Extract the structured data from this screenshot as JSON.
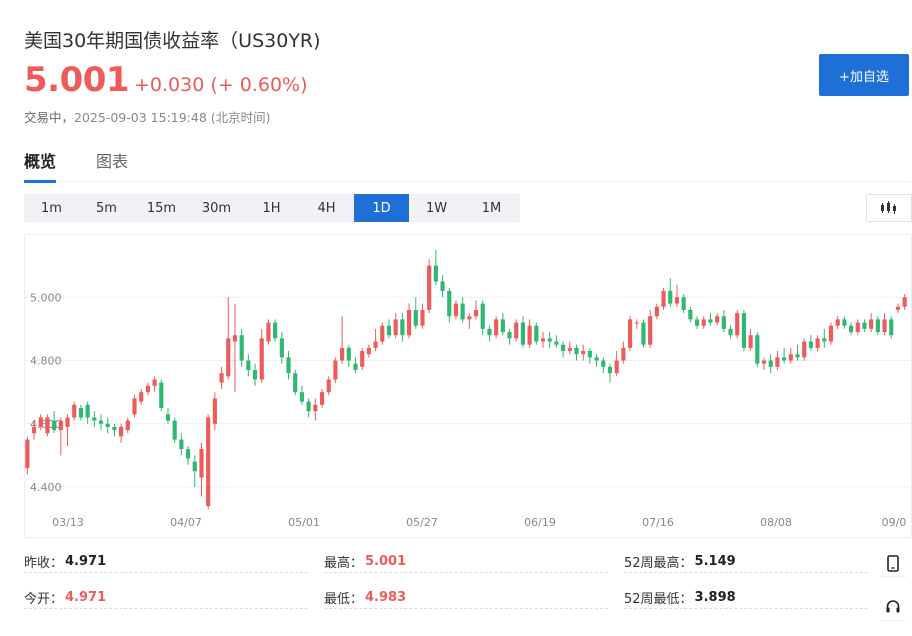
{
  "header": {
    "title": "美国30年期国债收益率（US30YR)",
    "price": "5.001",
    "change": "+0.030 (+ 0.60%)",
    "status": "交易中，",
    "timestamp": "2025-09-03 15:19:48 (北京时间)",
    "add_button": "+加自选"
  },
  "tabs": [
    {
      "label": "概览",
      "active": true
    },
    {
      "label": "图表",
      "active": false
    }
  ],
  "periods": [
    {
      "label": "1m",
      "active": false
    },
    {
      "label": "5m",
      "active": false
    },
    {
      "label": "15m",
      "active": false
    },
    {
      "label": "30m",
      "active": false
    },
    {
      "label": "1H",
      "active": false
    },
    {
      "label": "4H",
      "active": false
    },
    {
      "label": "1D",
      "active": true
    },
    {
      "label": "1W",
      "active": false
    },
    {
      "label": "1M",
      "active": false
    }
  ],
  "stats": {
    "prev_close_label": "昨收：",
    "prev_close": "4.971",
    "open_label": "今开：",
    "open": "4.971",
    "high_label": "最高：",
    "high": "5.001",
    "low_label": "最低：",
    "low": "4.983",
    "wk52_high_label": "52周最高：",
    "wk52_high": "5.149",
    "wk52_low_label": "52周最低：",
    "wk52_low": "3.898"
  },
  "colors": {
    "up": "#ee5b5b",
    "down": "#2eb872",
    "accent": "#1f70d6"
  },
  "icons": {
    "chart_type": "candlestick-icon",
    "mobile": "mobile-phone-icon",
    "support": "headset-icon"
  },
  "chart_data": {
    "type": "candlestick",
    "title": "",
    "xlabel": "",
    "ylabel": "",
    "yticks": [
      "4.400",
      "4.600",
      "4.800",
      "5.000"
    ],
    "ylim": [
      4.34,
      5.2
    ],
    "xtick_labels": [
      "03/13",
      "04/07",
      "05/01",
      "05/27",
      "06/19",
      "07/16",
      "08/08",
      "09/0"
    ],
    "grid": true,
    "legend": false,
    "candles": [
      [
        4.46,
        4.55,
        4.44,
        4.56
      ],
      [
        4.57,
        4.59,
        4.55,
        4.61
      ],
      [
        4.59,
        4.62,
        4.58,
        4.63
      ],
      [
        4.57,
        4.62,
        4.56,
        4.63
      ],
      [
        4.61,
        4.58,
        4.57,
        4.64
      ],
      [
        4.58,
        4.61,
        4.5,
        4.62
      ],
      [
        4.59,
        4.62,
        4.53,
        4.63
      ],
      [
        4.62,
        4.66,
        4.61,
        4.67
      ],
      [
        4.65,
        4.62,
        4.61,
        4.66
      ],
      [
        4.66,
        4.62,
        4.6,
        4.67
      ],
      [
        4.62,
        4.61,
        4.59,
        4.64
      ],
      [
        4.61,
        4.6,
        4.58,
        4.63
      ],
      [
        4.6,
        4.59,
        4.57,
        4.62
      ],
      [
        4.59,
        4.58,
        4.56,
        4.6
      ],
      [
        4.56,
        4.59,
        4.54,
        4.6
      ],
      [
        4.58,
        4.61,
        4.57,
        4.62
      ],
      [
        4.63,
        4.68,
        4.62,
        4.69
      ],
      [
        4.67,
        4.7,
        4.66,
        4.71
      ],
      [
        4.7,
        4.72,
        4.69,
        4.73
      ],
      [
        4.72,
        4.74,
        4.7,
        4.75
      ],
      [
        4.73,
        4.65,
        4.64,
        4.74
      ],
      [
        4.63,
        4.61,
        4.6,
        4.65
      ],
      [
        4.61,
        4.55,
        4.54,
        4.62
      ],
      [
        4.55,
        4.52,
        4.5,
        4.57
      ],
      [
        4.52,
        4.49,
        4.47,
        4.53
      ],
      [
        4.48,
        4.45,
        4.4,
        4.5
      ],
      [
        4.43,
        4.52,
        4.37,
        4.54
      ],
      [
        4.34,
        4.62,
        4.33,
        4.63
      ],
      [
        4.6,
        4.68,
        4.58,
        4.7
      ],
      [
        4.73,
        4.76,
        4.71,
        4.78
      ],
      [
        4.75,
        4.87,
        4.74,
        5.0
      ],
      [
        4.86,
        4.88,
        4.7,
        4.98
      ],
      [
        4.88,
        4.8,
        4.78,
        4.9
      ],
      [
        4.8,
        4.77,
        4.75,
        4.82
      ],
      [
        4.77,
        4.74,
        4.72,
        4.79
      ],
      [
        4.74,
        4.87,
        4.73,
        4.9
      ],
      [
        4.86,
        4.92,
        4.85,
        4.93
      ],
      [
        4.92,
        4.87,
        4.86,
        4.93
      ],
      [
        4.87,
        4.81,
        4.79,
        4.89
      ],
      [
        4.81,
        4.76,
        4.74,
        4.83
      ],
      [
        4.76,
        4.7,
        4.69,
        4.77
      ],
      [
        4.7,
        4.67,
        4.66,
        4.72
      ],
      [
        4.67,
        4.64,
        4.62,
        4.68
      ],
      [
        4.64,
        4.66,
        4.61,
        4.68
      ],
      [
        4.66,
        4.7,
        4.65,
        4.71
      ],
      [
        4.7,
        4.74,
        4.69,
        4.75
      ],
      [
        4.74,
        4.8,
        4.73,
        4.81
      ],
      [
        4.8,
        4.84,
        4.79,
        4.94
      ],
      [
        4.84,
        4.8,
        4.78,
        4.85
      ],
      [
        4.79,
        4.77,
        4.76,
        4.81
      ],
      [
        4.78,
        4.83,
        4.77,
        4.84
      ],
      [
        4.82,
        4.84,
        4.81,
        4.85
      ],
      [
        4.84,
        4.86,
        4.83,
        4.9
      ],
      [
        4.86,
        4.91,
        4.85,
        4.92
      ],
      [
        4.91,
        4.88,
        4.87,
        4.93
      ],
      [
        4.88,
        4.93,
        4.87,
        4.95
      ],
      [
        4.93,
        4.88,
        4.86,
        4.95
      ],
      [
        4.88,
        4.96,
        4.87,
        4.98
      ],
      [
        4.96,
        4.91,
        4.9,
        5.0
      ],
      [
        4.91,
        4.96,
        4.9,
        4.98
      ],
      [
        4.96,
        5.1,
        4.95,
        5.12
      ],
      [
        5.1,
        5.05,
        5.04,
        5.15
      ],
      [
        5.05,
        5.02,
        5.0,
        5.07
      ],
      [
        5.02,
        4.94,
        4.92,
        5.03
      ],
      [
        4.94,
        4.98,
        4.93,
        4.99
      ],
      [
        4.98,
        4.93,
        4.92,
        5.0
      ],
      [
        4.93,
        4.94,
        4.9,
        4.95
      ],
      [
        4.94,
        4.96,
        4.93,
        4.99
      ],
      [
        4.98,
        4.9,
        4.88,
        4.99
      ],
      [
        4.9,
        4.88,
        4.86,
        4.91
      ],
      [
        4.88,
        4.93,
        4.87,
        4.94
      ],
      [
        4.93,
        4.89,
        4.88,
        4.95
      ],
      [
        4.89,
        4.87,
        4.85,
        4.9
      ],
      [
        4.87,
        4.92,
        4.86,
        4.93
      ],
      [
        4.92,
        4.85,
        4.84,
        4.94
      ],
      [
        4.85,
        4.91,
        4.84,
        4.93
      ],
      [
        4.91,
        4.86,
        4.85,
        4.92
      ],
      [
        4.86,
        4.87,
        4.84,
        4.89
      ],
      [
        4.87,
        4.86,
        4.84,
        4.89
      ],
      [
        4.86,
        4.85,
        4.84,
        4.88
      ],
      [
        4.85,
        4.83,
        4.81,
        4.86
      ],
      [
        4.83,
        4.84,
        4.82,
        4.86
      ],
      [
        4.84,
        4.82,
        4.8,
        4.85
      ],
      [
        4.82,
        4.83,
        4.8,
        4.85
      ],
      [
        4.83,
        4.81,
        4.79,
        4.84
      ],
      [
        4.81,
        4.8,
        4.78,
        4.82
      ],
      [
        4.8,
        4.78,
        4.76,
        4.81
      ],
      [
        4.78,
        4.76,
        4.73,
        4.79
      ],
      [
        4.76,
        4.8,
        4.75,
        4.83
      ],
      [
        4.8,
        4.84,
        4.79,
        4.86
      ],
      [
        4.84,
        4.93,
        4.83,
        4.94
      ],
      [
        4.92,
        4.92,
        4.9,
        4.93
      ],
      [
        4.92,
        4.85,
        4.84,
        4.93
      ],
      [
        4.85,
        4.94,
        4.84,
        4.96
      ],
      [
        4.94,
        4.97,
        4.93,
        4.98
      ],
      [
        4.97,
        5.02,
        4.96,
        5.03
      ],
      [
        5.02,
        4.98,
        4.97,
        5.06
      ],
      [
        4.98,
        5.0,
        4.97,
        5.04
      ],
      [
        5.0,
        4.96,
        4.95,
        5.01
      ],
      [
        4.96,
        4.93,
        4.92,
        4.97
      ],
      [
        4.93,
        4.91,
        4.9,
        4.94
      ],
      [
        4.91,
        4.93,
        4.9,
        4.94
      ],
      [
        4.93,
        4.92,
        4.91,
        4.95
      ],
      [
        4.92,
        4.94,
        4.91,
        4.95
      ],
      [
        4.94,
        4.9,
        4.89,
        4.96
      ],
      [
        4.9,
        4.88,
        4.87,
        4.91
      ],
      [
        4.88,
        4.95,
        4.87,
        4.96
      ],
      [
        4.95,
        4.84,
        4.83,
        4.96
      ],
      [
        4.84,
        4.88,
        4.83,
        4.9
      ],
      [
        4.88,
        4.79,
        4.78,
        4.89
      ],
      [
        4.79,
        4.8,
        4.77,
        4.81
      ],
      [
        4.8,
        4.78,
        4.76,
        4.82
      ],
      [
        4.78,
        4.81,
        4.77,
        4.83
      ],
      [
        4.81,
        4.8,
        4.79,
        4.84
      ],
      [
        4.8,
        4.82,
        4.79,
        4.84
      ],
      [
        4.82,
        4.81,
        4.8,
        4.85
      ],
      [
        4.81,
        4.86,
        4.8,
        4.87
      ],
      [
        4.86,
        4.84,
        4.83,
        4.88
      ],
      [
        4.84,
        4.87,
        4.83,
        4.88
      ],
      [
        4.87,
        4.86,
        4.84,
        4.9
      ],
      [
        4.86,
        4.91,
        4.85,
        4.92
      ],
      [
        4.91,
        4.93,
        4.9,
        4.94
      ],
      [
        4.93,
        4.91,
        4.9,
        4.94
      ],
      [
        4.91,
        4.89,
        4.88,
        4.92
      ],
      [
        4.89,
        4.92,
        4.88,
        4.93
      ],
      [
        4.92,
        4.9,
        4.89,
        4.93
      ],
      [
        4.9,
        4.93,
        4.89,
        4.95
      ],
      [
        4.93,
        4.89,
        4.88,
        4.94
      ],
      [
        4.89,
        4.93,
        4.88,
        4.95
      ],
      [
        4.93,
        4.88,
        4.87,
        4.94
      ],
      [
        4.96,
        4.97,
        4.95,
        4.98
      ],
      [
        4.97,
        5.0,
        4.96,
        5.01
      ]
    ]
  }
}
